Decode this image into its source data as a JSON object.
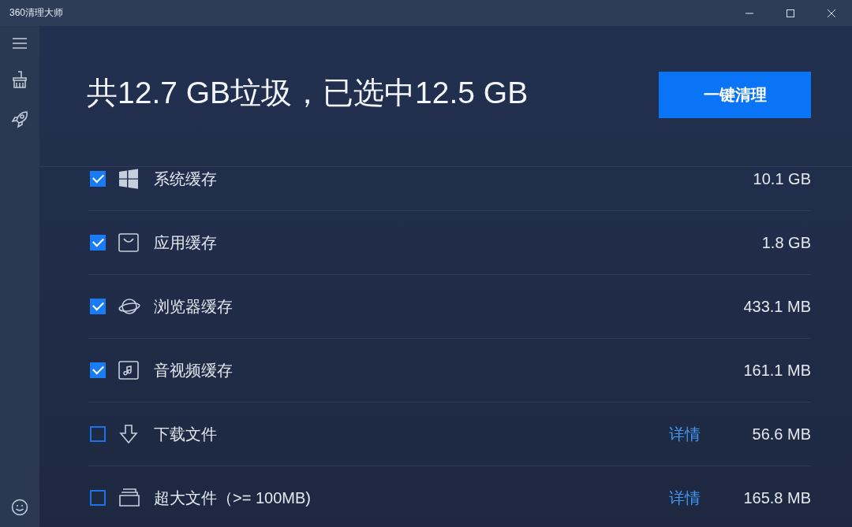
{
  "window": {
    "title": "360清理大师"
  },
  "summary": {
    "text": "共12.7 GB垃圾，已选中12.5 GB",
    "button": "一键清理"
  },
  "items": [
    {
      "label": "系统缓存",
      "size": "10.1 GB",
      "checked": true
    },
    {
      "label": "应用缓存",
      "size": "1.8 GB",
      "checked": true
    },
    {
      "label": "浏览器缓存",
      "size": "433.1 MB",
      "checked": true
    },
    {
      "label": "音视频缓存",
      "size": "161.1 MB",
      "checked": true
    },
    {
      "label": "下载文件",
      "size": "56.6 MB",
      "checked": false,
      "details": "详情"
    },
    {
      "label": "超大文件（>= 100MB)",
      "size": "165.8 MB",
      "checked": false,
      "details": "详情"
    }
  ]
}
